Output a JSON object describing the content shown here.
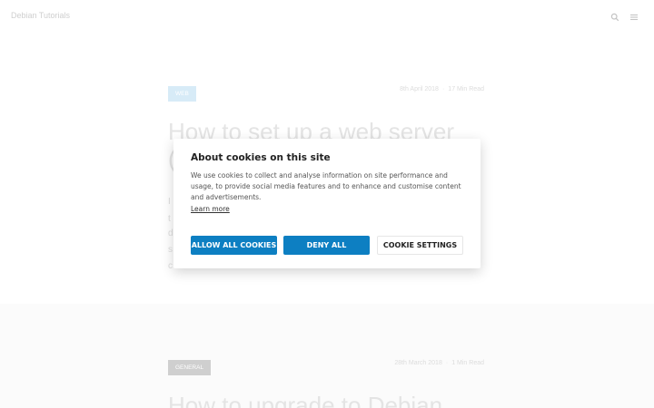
{
  "header": {
    "site_title": "Debian Tutorials",
    "search_icon": "search-icon",
    "menu_icon": "menu-icon"
  },
  "posts": [
    {
      "tag": "WEB",
      "date": "8th April 2018",
      "read_time": "17 Min Read",
      "title": "How to set up a web server",
      "title_line2_fragment": "(",
      "excerpt_fragments": [
        "I",
        "t",
        "d",
        "s",
        "c"
      ]
    },
    {
      "tag": "GENERAL",
      "date": "28th March 2018",
      "read_time": "1 Min Read",
      "title": "How to upgrade to Debian"
    }
  ],
  "cookie_dialog": {
    "title": "About cookies on this site",
    "body": "We use cookies to collect and analyse information on site performance and usage, to provide social media features and to enhance and customise content and advertisements.",
    "learn_more": "Learn more",
    "allow_all": "ALLOW ALL COOKIES",
    "deny_all": "DENY ALL",
    "settings": "COOKIE SETTINGS",
    "accent_color": "#0d7fc2"
  }
}
